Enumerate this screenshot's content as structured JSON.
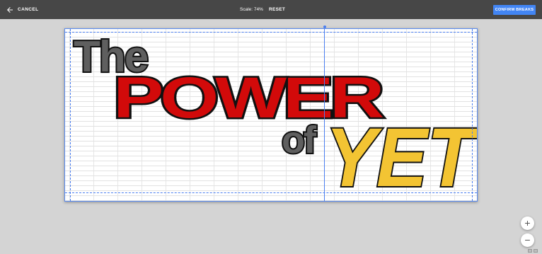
{
  "toolbar": {
    "cancel_label": "CANCEL",
    "scale_text": "Scale: 74%",
    "reset_label": "RESET",
    "confirm_label": "CONFIRM BREAKS",
    "confirm_color": "#4285f4",
    "bar_color": "#474747"
  },
  "sheet": {
    "art_text": {
      "word1": "The",
      "word2": "POWER",
      "word3": "of",
      "word4": "YET"
    },
    "colors": {
      "grey": "#5f5f5f",
      "red": "#d20a0a",
      "yellow": "#f3c433",
      "margin": "#4a7ef0"
    }
  },
  "zoom": {
    "in_symbol": "+",
    "out_symbol": "−"
  },
  "icons": {
    "back": "arrow-left-icon",
    "zoom_in": "plus-icon",
    "zoom_out": "minus-icon"
  }
}
